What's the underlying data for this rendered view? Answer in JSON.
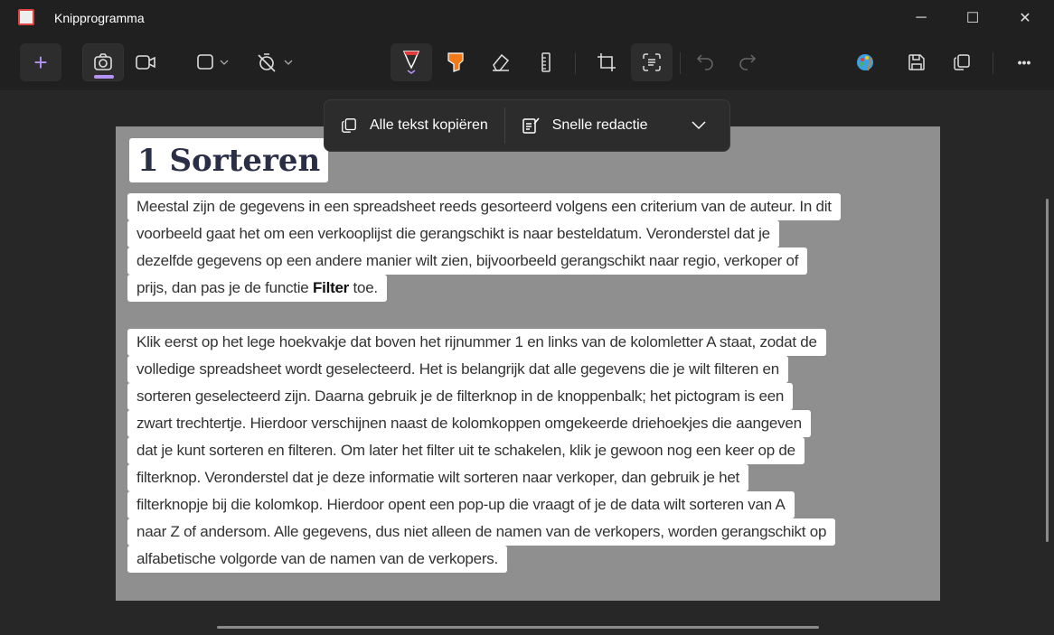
{
  "window": {
    "title": "Knipprogramma",
    "minimize": "─",
    "maximize": "☐",
    "close": "✕"
  },
  "toolbar": {
    "new": "+",
    "more": "•••",
    "colors": {
      "accent": "#b693f5",
      "pen": "#e23b3b",
      "highlighter": "#f07a1a"
    }
  },
  "popup": {
    "copy_all": "Alle tekst kopiëren",
    "quick_redact": "Snelle redactie",
    "chevron": "⌄"
  },
  "document": {
    "heading": "1 Sorteren",
    "paragraph1": [
      "Meestal zijn de gegevens in een spreadsheet reeds gesorteerd volgens een criterium van de auteur. In dit",
      "voorbeeld gaat het om een verkooplijst die gerangschikt is naar besteldatum. Veronderstel dat je",
      "dezelfde gegevens op een andere manier wilt zien, bijvoorbeeld gerangschikt naar regio, verkoper of"
    ],
    "paragraph1_last": {
      "before": "prijs, dan pas je de functie ",
      "bold": "Filter",
      "after": " toe."
    },
    "paragraph2": [
      "Klik eerst op het lege hoekvakje dat boven het rijnummer 1 en links van de kolomletter A staat, zodat de",
      "volledige spreadsheet wordt geselecteerd. Het is belangrijk dat alle gegevens die je wilt filteren en",
      "sorteren geselecteerd zijn. Daarna gebruik je de filterknop in de knoppenbalk; het pictogram is een",
      "zwart trechtertje. Hierdoor verschijnen naast de kolomkoppen omgekeerde driehoekjes die aangeven",
      "dat je kunt sorteren en filteren. Om later het filter uit te schakelen, klik je gewoon nog een keer op de",
      "filterknop. Veronderstel dat je deze informatie wilt sorteren naar verkoper, dan gebruik je het",
      "filterknopje bij die kolomkop. Hierdoor opent een pop-up die vraagt of je de data wilt sorteren van A",
      "naar Z of andersom. Alle gegevens, dus niet alleen de namen van de verkopers, worden gerangschikt op",
      "alfabetische volgorde van de namen van de verkopers."
    ]
  }
}
